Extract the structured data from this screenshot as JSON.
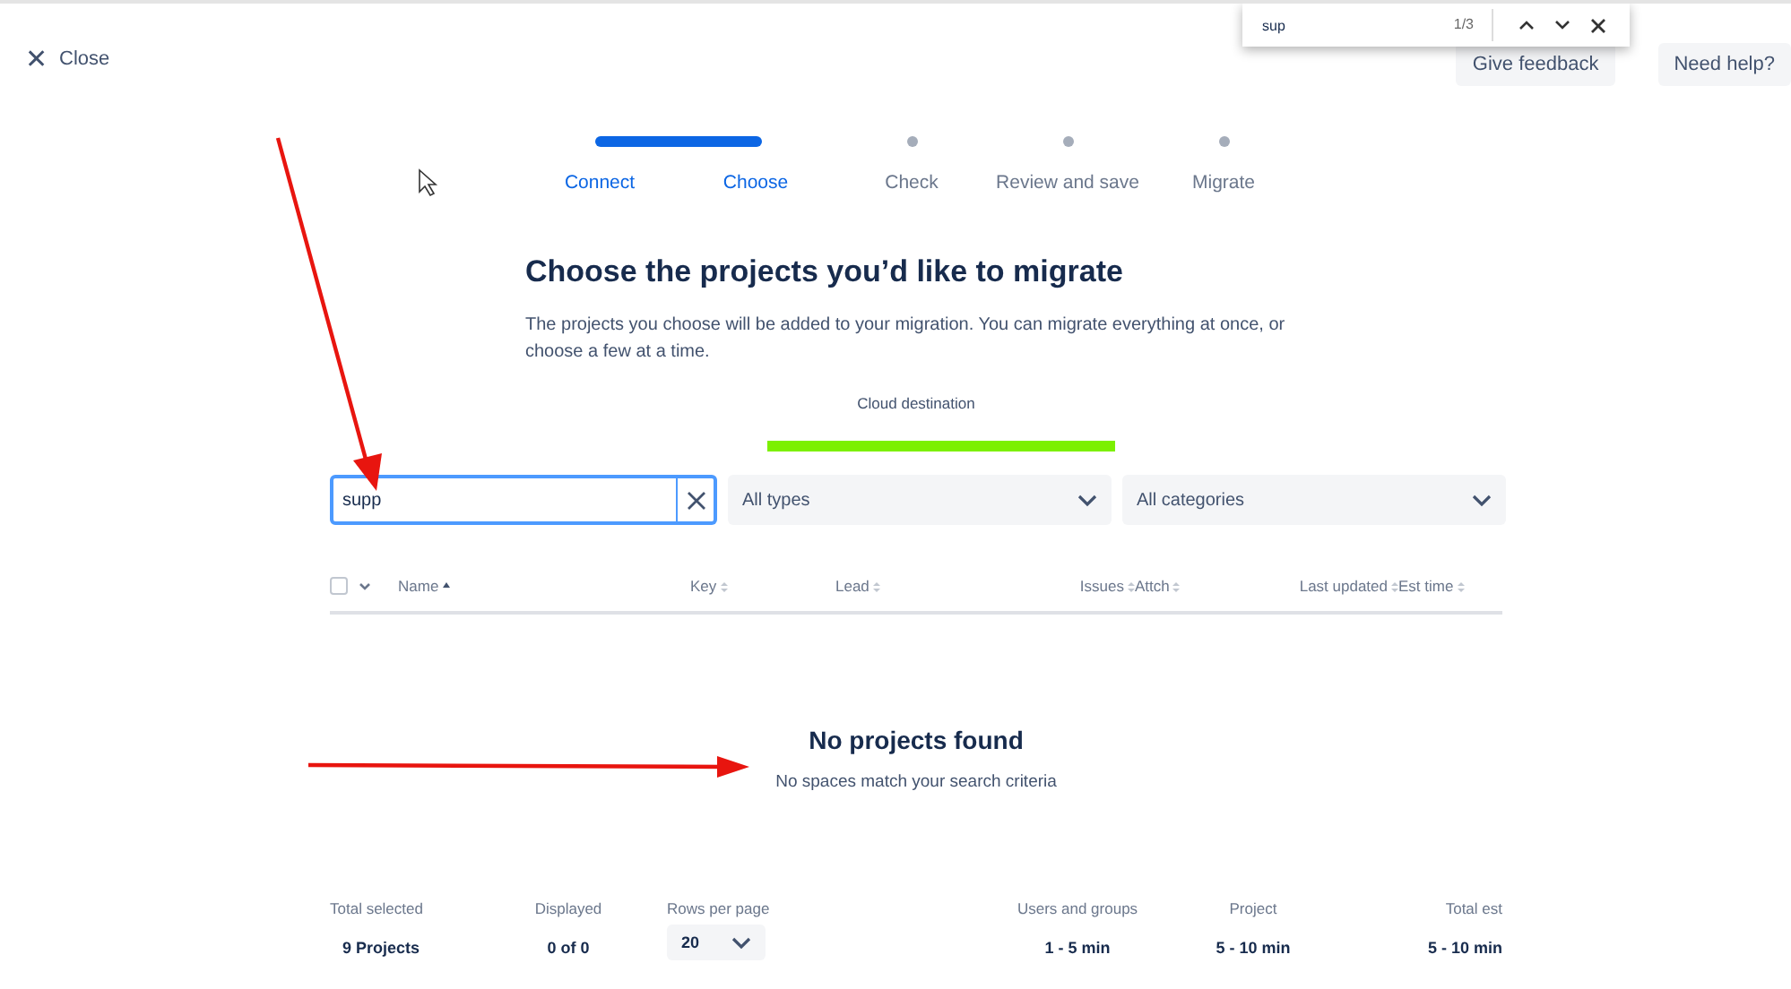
{
  "header": {
    "close": {
      "icon": "✕",
      "label": "Close"
    },
    "buttons": [
      "Give feedback",
      "Need help?"
    ]
  },
  "find_bar": {
    "query": "sup",
    "count": "1/3"
  },
  "steps": [
    {
      "label": "Connect",
      "completed": true
    },
    {
      "label": "Choose",
      "completed": true
    },
    {
      "label": "Check",
      "completed": false
    },
    {
      "label": "Review and save",
      "completed": false
    },
    {
      "label": "Migrate",
      "completed": false
    }
  ],
  "title": "Choose the projects you’d like to migrate",
  "description": "The projects you choose will be added to your migration. You can migrate everything at once, or choose a few at a time.",
  "destination_label": "Cloud destination",
  "search": {
    "value": "supp"
  },
  "filters": [
    "All types",
    "All categories"
  ],
  "table": {
    "columns": [
      {
        "label": "Name",
        "sorted": true
      },
      {
        "label": "Key",
        "sorted": false
      },
      {
        "label": "Lead",
        "sorted": false
      },
      {
        "label": "Issues",
        "sorted": false
      },
      {
        "label": "Attch",
        "sorted": false
      },
      {
        "label": "Last updated",
        "sorted": false
      },
      {
        "label": "Est time",
        "sorted": false
      }
    ],
    "select_all": {
      "checked": false
    }
  },
  "empty": {
    "title": "No projects found",
    "message": "No spaces match your search criteria"
  },
  "footer": [
    {
      "label": "Total selected",
      "value": "9 Projects",
      "kind": "text"
    },
    {
      "label": "Displayed",
      "value": "0 of 0",
      "kind": "text"
    },
    {
      "label": "Rows per page",
      "value": "20",
      "kind": "select"
    },
    {
      "label": "Users and groups",
      "value": "1 - 5 min",
      "kind": "text"
    },
    {
      "label": "Project",
      "value": "5 - 10 min",
      "kind": "text"
    },
    {
      "label": "Total est",
      "value": "5 - 10 min",
      "kind": "text"
    }
  ]
}
